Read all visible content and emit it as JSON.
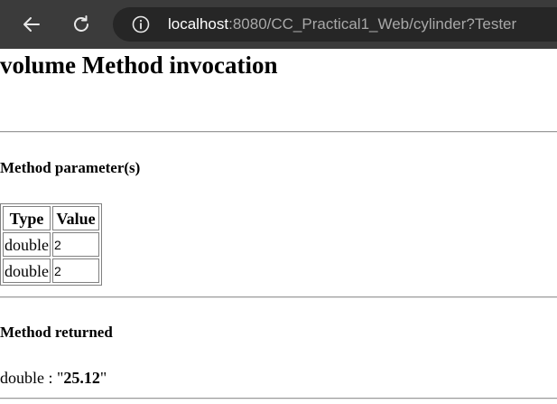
{
  "browser": {
    "url_host": "localhost",
    "url_rest": ":8080/CC_Practical1_Web/cylinder?Tester",
    "back_icon": "arrow-left-icon",
    "reload_icon": "reload-icon",
    "info_icon": "info-icon"
  },
  "page": {
    "title": "volume Method invocation",
    "params_heading": "Method parameter(s)",
    "table": {
      "headers": [
        "Type",
        "Value"
      ],
      "rows": [
        [
          "double",
          "2"
        ],
        [
          "double",
          "2"
        ]
      ]
    },
    "returned_heading": "Method returned",
    "result_type": "double :",
    "result_open_quote": "\"",
    "result_value": "25.12",
    "result_close_quote": "\""
  }
}
